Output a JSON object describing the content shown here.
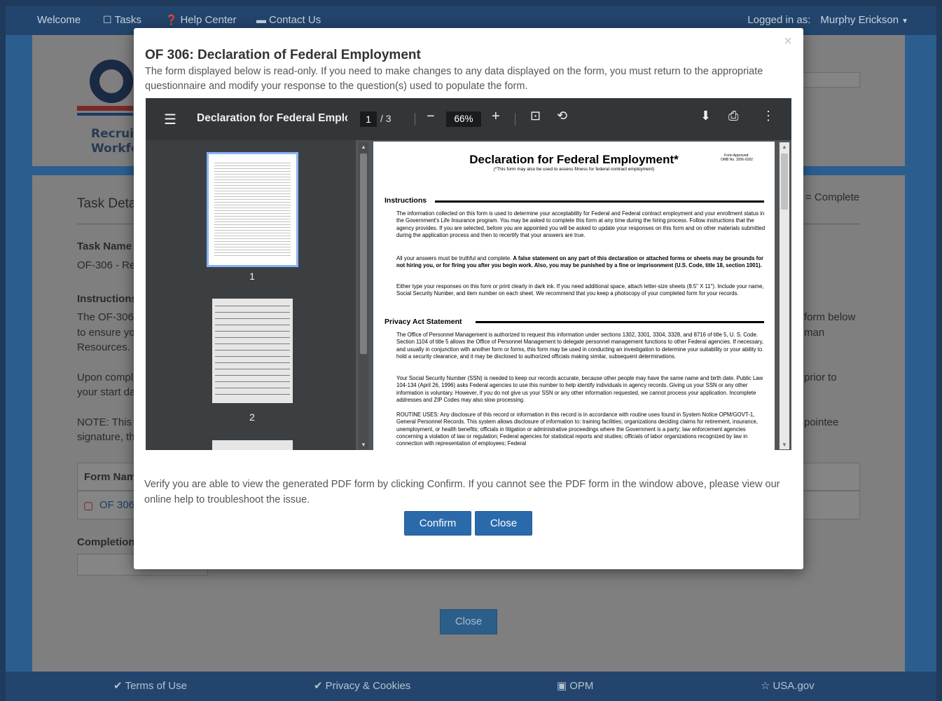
{
  "nav": {
    "welcome": "Welcome",
    "tasks": "Tasks",
    "help_center": "Help Center",
    "contact_us": "Contact Us",
    "logged_in_label": "Logged in as:",
    "user_name": "Murphy Erickson"
  },
  "background": {
    "logo_line1": "Recruit",
    "logo_line2": "Workfo",
    "task_details": "Task Deta",
    "status_legend": "= Complete",
    "task_name_label": "Task Name",
    "task_name_value": "OF-306 - Re",
    "instructions_label": "Instructions",
    "instr_line1": "The OF-306",
    "instr_line2": "to ensure yo",
    "instr_line3": "Resources.",
    "instr_right1": "form below",
    "instr_right2": "man",
    "upon_line1": "Upon compl",
    "upon_line2": "your start da",
    "upon_right": "prior to",
    "note_line1": "NOTE: This",
    "note_line2": "signature, th",
    "note_right": "pointee",
    "form_name_header": "Form Nam",
    "form_link": "OF 306",
    "completion_label": "Completion",
    "close_button": "Close"
  },
  "footer": {
    "terms": "Terms of Use",
    "privacy": "Privacy & Cookies",
    "opm": "OPM",
    "usagov": "USA.gov"
  },
  "modal": {
    "close_x": "×",
    "title": "OF 306: Declaration of Federal Employment",
    "description": "The form displayed below is read-only. If you need to make changes to any data displayed on the form, you must return to the appropriate questionnaire and modify your response to the question(s) used to populate the form.",
    "verify_text": "Verify you are able to view the generated PDF form by clicking Confirm. If you cannot see the PDF form in the window above, please view our online help to troubleshoot the issue.",
    "confirm_button": "Confirm",
    "close_button": "Close"
  },
  "viewer": {
    "doc_title": "Declaration for Federal Emplo...",
    "current_page": "1",
    "page_total": "/ 3",
    "zoom": "66%",
    "thumb1_num": "1",
    "thumb2_num": "2"
  },
  "pdf": {
    "title": "Declaration for Federal Employment*",
    "subtitle": "(*This form may also be used to assess fitness for federal contract employment)",
    "omb_line1": "Form Approved:",
    "omb_line2": "OMB No. 3206-0182",
    "instructions_heading": "Instructions",
    "instr_p1": "The information collected on this form is used to determine your acceptability for Federal and Federal contract employment and your enrollment status in the Government's Life Insurance program. You may be asked to complete this form at any time during the hiring process. Follow instructions that the agency provides. If you are selected, before you are appointed you will be asked to update your responses on this form and on other materials submitted during the application process and then to recertify that your answers are true.",
    "instr_p2_normal": "All your answers must be truthful and complete.",
    "instr_p2_bold": "A false statement on any part of this declaration or attached forms or sheets may be grounds for not hiring you, or for firing you after you begin work. Also, you may be punished by a fine or imprisonment (U.S. Code, title 18, section 1001).",
    "instr_p3": "Either type your responses on this form or print clearly in dark ink. If you need additional space, attach letter-size sheets (8.5\" X 11\"). Include your name, Social Security Number, and item number on each sheet. We recommend that you keep a photocopy of your completed form for your records.",
    "privacy_heading": "Privacy Act Statement",
    "priv_p1": "The Office of Personnel Management is authorized to request this information under sections 1302, 3301, 3304, 3328, and 8716 of title 5, U. S. Code. Section 1104 of title 5 allows the Office of Personnel Management to delegate personnel management functions to other Federal agencies. If necessary, and usually in conjunction with another form or forms, this form may be used in conducting an investigation to determine your suitability or your ability to hold a security clearance, and it may be disclosed to authorized officials making similar, subsequent determinations.",
    "priv_p2": "Your Social Security Number (SSN) is needed to keep our records accurate, because other people may have the same name and birth date. Public Law 104-134 (April 26, 1996) asks Federal agencies to use this number to help identify individuals in agency records. Giving us your SSN or any other information is voluntary. However, if you do not give us your SSN or any other information requested, we cannot process your application. Incomplete addresses and ZIP Codes may also slow processing.",
    "priv_p3": "ROUTINE USES: Any disclosure of this record or information in this record is in accordance with routine uses found in System Notice OPM/GOVT-1, General Personnel Records. This system allows disclosure of information to: training facilities; organizations deciding claims for retirement, insurance, unemployment, or health benefits; officials in litigation or administrative proceedings where the Government is a party; law enforcement agencies concerning a violation of law or regulation; Federal agencies for statistical reports and studies; officials of labor organizations recognized by law in connection with representation of employees; Federal"
  }
}
